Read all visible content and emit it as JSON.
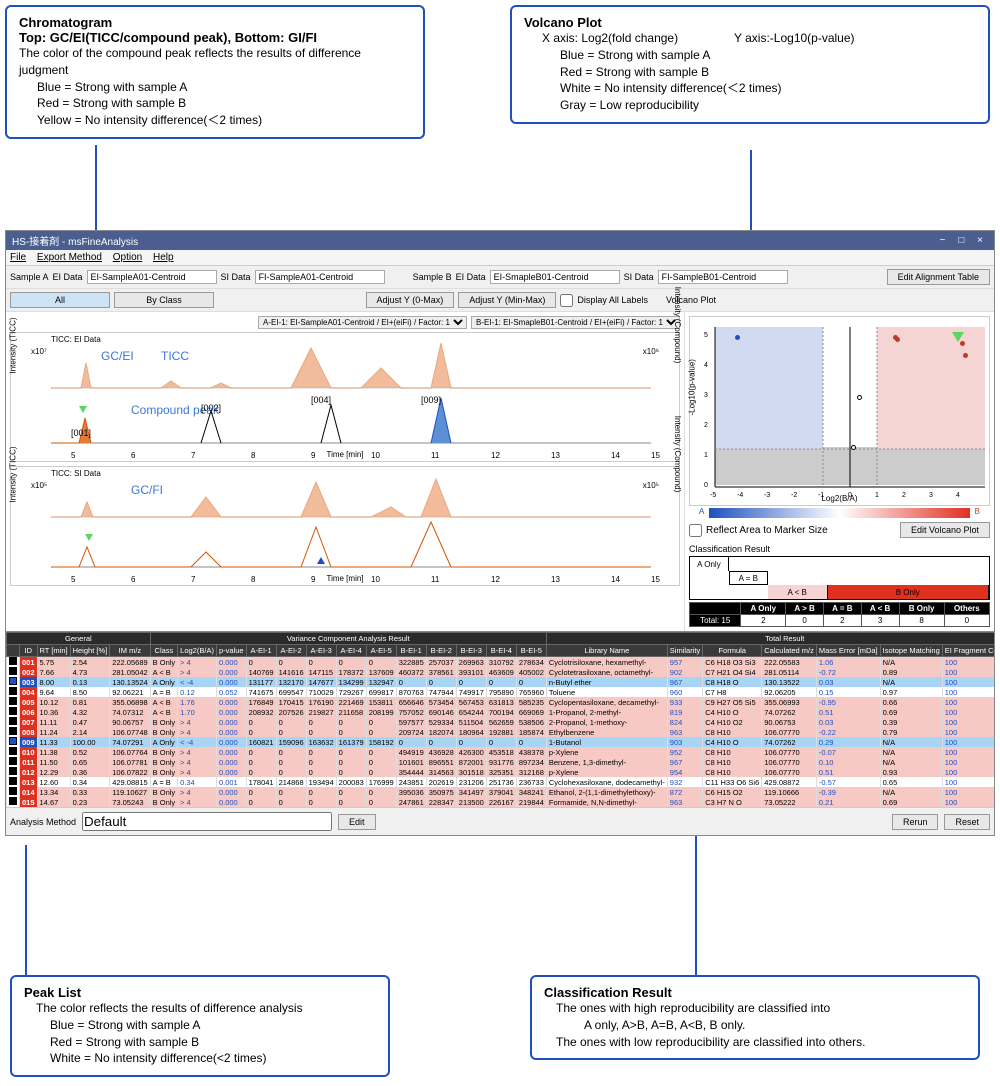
{
  "callouts": {
    "chromatogram": {
      "title": "Chromatogram",
      "subtitle": "Top: GC/EI(TICC/compound peak), Bottom: GI/FI",
      "desc": "The color of the compound peak reflects the results of difference judgment",
      "blue": "Blue = Strong with sample A",
      "red": "Red = Strong with sample B",
      "yellow": "Yellow = No intensity difference(＜2 times)"
    },
    "volcano": {
      "title": "Volcano Plot",
      "xaxis": "X axis: Log2(fold change)",
      "yaxis": "Y axis:-Log10(p-value)",
      "blue": "Blue = Strong with sample A",
      "red": "Red = Strong with sample B",
      "white": "White = No intensity difference(＜2 times)",
      "gray": "Gray = Low reproducibility"
    },
    "peaklist": {
      "title": "Peak List",
      "desc": "The color reflects the results of difference analysis",
      "blue": "Blue = Strong with sample A",
      "red": "Red = Strong with sample B",
      "white": "White = No intensity difference(<2 times)"
    },
    "classresult": {
      "title": "Classification Result",
      "line1": "The ones with high reproducibility are classified into",
      "line2": "A only, A>B, A=B, A<B, B only.",
      "line3": "The ones with low reproducibility are classified into others."
    }
  },
  "window": {
    "title": "HS-接着剤 - msFineAnalysis",
    "win_min": "−",
    "win_max": "□",
    "win_close": "×",
    "menu": {
      "file": "File",
      "export": "Export Method",
      "option": "Option",
      "help": "Help"
    },
    "sampleA": "Sample A",
    "sampleB": "Sample B",
    "eidata": "EI Data",
    "sidata": "SI Data",
    "eiA": "EI-SampleA01-Centroid",
    "siA": "FI-SampleA01-Centroid",
    "eiB": "EI-SmapleB01-Centroid",
    "siB": "FI-SampleB01-Centroid",
    "editAlign": "Edit Alignment Table",
    "btnAll": "All",
    "btnByClass": "By Class",
    "btnAdjY0": "Adjust Y (0-Max)",
    "btnAdjYmm": "Adjust Y (Min-Max)",
    "chkDisplayAll": "Display All Labels",
    "volcanoLabel": "Volcano Plot",
    "dropA": "A-EI-1: EI-SampleA01-Centroid / EI+(eiFi) / Factor: 1",
    "dropB": "B-EI-1: EI-SmapleB01-Centroid / EI+(eiFi) / Factor: 1",
    "analysisMethod": "Analysis Method",
    "analysisMethodVal": "Default",
    "editBtn": "Edit",
    "rerun": "Rerun",
    "reset": "Reset"
  },
  "chrom": {
    "ticc_ei": "TICC: EI Data",
    "ticc_si": "TICC: SI Data",
    "ylabel": "Intensity (TICC)",
    "ylabel2": "Intensity (Compound)",
    "xlabel": "Time [min]",
    "y1_left": "x10⁷",
    "y1_right": "x10⁶",
    "y2_left": "x10⁵",
    "y2_right": "x10⁵",
    "gcei": "GC/EI",
    "ticc": "TICC",
    "compound_peak": "Compound peak",
    "gcfi": "GC/FI",
    "tag001": "[001]",
    "tag002": "[002]",
    "tag004": "[004]",
    "tag009": "[009]"
  },
  "volcano": {
    "ylabel": "-Log10(p-value)",
    "xlabel": "Log2(B/A)",
    "labelA": "A",
    "labelB": "B",
    "chkReflect": "Reflect Area to Marker Size",
    "editBtn": "Edit Volcano Plot"
  },
  "classResult": {
    "title": "Classification Result",
    "aonly": "A Only",
    "aeqb": "A = B",
    "altb": "A < B",
    "bonly": "B Only",
    "headers": [
      "",
      "A Only",
      "A > B",
      "A = B",
      "A < B",
      "B Only",
      "Others"
    ],
    "row": [
      "Total: 15",
      "2",
      "0",
      "2",
      "3",
      "8",
      "0"
    ]
  },
  "table": {
    "groups": {
      "general": "General",
      "variance": "Variance Component Analysis Result",
      "total": "Total Result"
    },
    "headers": [
      "",
      "ID",
      "RT [min]",
      "Height [%]",
      "IM m/z",
      "Class",
      "Log2(B/A)",
      "p-value",
      "A-EI-1",
      "A-EI-2",
      "A-EI-3",
      "A-EI-4",
      "A-EI-5",
      "B-EI-1",
      "B-EI-2",
      "B-EI-3",
      "B-EI-4",
      "B-EI-5",
      "Library Name",
      "Similarity",
      "Formula",
      "Calculated m/z",
      "Mass Error [mDa]",
      "Isotope Matching",
      "EI Fragment Coverage"
    ],
    "rows": [
      {
        "cls": "red",
        "id": "001",
        "rt": "5.75",
        "h": "2.54",
        "mz": "222.05689",
        "class": "B Only",
        "log": "> 4",
        "p": "0.000",
        "a1": "0",
        "a2": "0",
        "a3": "0",
        "a4": "0",
        "a5": "0",
        "b1": "322885",
        "b2": "257037",
        "b3": "269963",
        "b4": "310792",
        "b5": "278634",
        "lib": "Cyclotrisiloxane, hexamethyl-",
        "sim": "957",
        "for": "C6 H18 O3 Si3",
        "cmz": "222.05583",
        "err": "1.06",
        "iso": "N/A",
        "cov": "100"
      },
      {
        "cls": "red",
        "id": "002",
        "rt": "7.66",
        "h": "4.73",
        "mz": "281.05042",
        "class": "A < B",
        "log": "> 4",
        "p": "0.000",
        "a1": "140769",
        "a2": "141616",
        "a3": "147115",
        "a4": "178372",
        "a5": "137609",
        "b1": "460372",
        "b2": "378561",
        "b3": "393101",
        "b4": "463609",
        "b5": "405002",
        "lib": "Cyclotetrasiloxane, octamethyl-",
        "sim": "902",
        "for": "C7 H21 O4 Si4",
        "cmz": "281.05114",
        "err": "-0.72",
        "iso": "0.89",
        "cov": "100"
      },
      {
        "cls": "blue",
        "id": "003",
        "rt": "8.00",
        "h": "0.13",
        "mz": "130.13524",
        "class": "A Only",
        "log": "< -4",
        "p": "0.000",
        "a1": "131177",
        "a2": "132170",
        "a3": "147677",
        "a4": "134299",
        "a5": "132947",
        "b1": "0",
        "b2": "0",
        "b3": "0",
        "b4": "0",
        "b5": "0",
        "lib": "n-Butyl ether",
        "sim": "967",
        "for": "C8 H18 O",
        "cmz": "130.13522",
        "err": "0.03",
        "iso": "N/A",
        "cov": "100"
      },
      {
        "cls": "white",
        "id": "004",
        "rt": "9.64",
        "h": "8.50",
        "mz": "92.06221",
        "class": "A = B",
        "log": "0.12",
        "p": "0.052",
        "a1": "741675",
        "a2": "699547",
        "a3": "710029",
        "a4": "729267",
        "a5": "699817",
        "b1": "870763",
        "b2": "747944",
        "b3": "749917",
        "b4": "795890",
        "b5": "765960",
        "lib": "Toluene",
        "sim": "960",
        "for": "C7 H8",
        "cmz": "92.06205",
        "err": "0.15",
        "iso": "0.97",
        "cov": "100"
      },
      {
        "cls": "red",
        "id": "005",
        "rt": "10.12",
        "h": "0.81",
        "mz": "355.06898",
        "class": "A < B",
        "log": "1.76",
        "p": "0.000",
        "a1": "176849",
        "a2": "170415",
        "a3": "176190",
        "a4": "221469",
        "a5": "153811",
        "b1": "656646",
        "b2": "573454",
        "b3": "567453",
        "b4": "631813",
        "b5": "585235",
        "lib": "Cyclopentasiloxane, decamethyl-",
        "sim": "933",
        "for": "C9 H27 O5 Si5",
        "cmz": "355.06993",
        "err": "-0.95",
        "iso": "0.66",
        "cov": "100"
      },
      {
        "cls": "red",
        "id": "006",
        "rt": "10.36",
        "h": "4.32",
        "mz": "74.07312",
        "class": "A < B",
        "log": "1.70",
        "p": "0.000",
        "a1": "208932",
        "a2": "207526",
        "a3": "219827",
        "a4": "211658",
        "a5": "208199",
        "b1": "757052",
        "b2": "690146",
        "b3": "654244",
        "b4": "700194",
        "b5": "669069",
        "lib": "1-Propanol, 2-methyl-",
        "sim": "819",
        "for": "C4 H10 O",
        "cmz": "74.07262",
        "err": "0.51",
        "iso": "0.69",
        "cov": "100"
      },
      {
        "cls": "red",
        "id": "007",
        "rt": "11.11",
        "h": "0.47",
        "mz": "90.06757",
        "class": "B Only",
        "log": "> 4",
        "p": "0.000",
        "a1": "0",
        "a2": "0",
        "a3": "0",
        "a4": "0",
        "a5": "0",
        "b1": "597577",
        "b2": "529334",
        "b3": "511504",
        "b4": "562659",
        "b5": "538506",
        "lib": "2-Propanol, 1-methoxy-",
        "sim": "824",
        "for": "C4 H10 O2",
        "cmz": "90.06753",
        "err": "0.03",
        "iso": "0.39",
        "cov": "100"
      },
      {
        "cls": "red",
        "id": "008",
        "rt": "11.24",
        "h": "2.14",
        "mz": "106.07748",
        "class": "B Only",
        "log": "> 4",
        "p": "0.000",
        "a1": "0",
        "a2": "0",
        "a3": "0",
        "a4": "0",
        "a5": "0",
        "b1": "209724",
        "b2": "182074",
        "b3": "180964",
        "b4": "192881",
        "b5": "185874",
        "lib": "Ethylbenzene",
        "sim": "963",
        "for": "C8 H10",
        "cmz": "106.07770",
        "err": "-0.22",
        "iso": "0.79",
        "cov": "100"
      },
      {
        "cls": "blue",
        "id": "009",
        "rt": "11.33",
        "h": "100.00",
        "mz": "74.07291",
        "class": "A Only",
        "log": "< -4",
        "p": "0.000",
        "a1": "160821",
        "a2": "159096",
        "a3": "163632",
        "a4": "161379",
        "a5": "158192",
        "b1": "0",
        "b2": "0",
        "b3": "0",
        "b4": "0",
        "b5": "0",
        "lib": "1-Butanol",
        "sim": "903",
        "for": "C4 H10 O",
        "cmz": "74.07262",
        "err": "0.29",
        "iso": "N/A",
        "cov": "100"
      },
      {
        "cls": "red",
        "id": "010",
        "rt": "11.38",
        "h": "0.52",
        "mz": "106.07764",
        "class": "B Only",
        "log": "> 4",
        "p": "0.000",
        "a1": "0",
        "a2": "0",
        "a3": "0",
        "a4": "0",
        "a5": "0",
        "b1": "494919",
        "b2": "436928",
        "b3": "426300",
        "b4": "453518",
        "b5": "438378",
        "lib": "p-Xylene",
        "sim": "952",
        "for": "C8 H10",
        "cmz": "106.07770",
        "err": "-0.07",
        "iso": "N/A",
        "cov": "100"
      },
      {
        "cls": "red",
        "id": "011",
        "rt": "11.50",
        "h": "0.65",
        "mz": "106.07781",
        "class": "B Only",
        "log": "> 4",
        "p": "0.000",
        "a1": "0",
        "a2": "0",
        "a3": "0",
        "a4": "0",
        "a5": "0",
        "b1": "101601",
        "b2": "896551",
        "b3": "872001",
        "b4": "931776",
        "b5": "897234",
        "lib": "Benzene, 1,3-dimethyl-",
        "sim": "967",
        "for": "C8 H10",
        "cmz": "106.07770",
        "err": "0.10",
        "iso": "N/A",
        "cov": "100"
      },
      {
        "cls": "red",
        "id": "012",
        "rt": "12.29",
        "h": "0.36",
        "mz": "106.07822",
        "class": "B Only",
        "log": "> 4",
        "p": "0.000",
        "a1": "0",
        "a2": "0",
        "a3": "0",
        "a4": "0",
        "a5": "0",
        "b1": "354444",
        "b2": "314563",
        "b3": "301518",
        "b4": "325351",
        "b5": "312168",
        "lib": "p-Xylene",
        "sim": "954",
        "for": "C8 H10",
        "cmz": "106.07770",
        "err": "0.51",
        "iso": "0.93",
        "cov": "100"
      },
      {
        "cls": "white",
        "id": "013",
        "rt": "12.60",
        "h": "0.34",
        "mz": "429.08815",
        "class": "A = B",
        "log": "0.34",
        "p": "0.001",
        "a1": "178041",
        "a2": "214868",
        "a3": "193494",
        "a4": "200083",
        "a5": "176999",
        "b1": "243851",
        "b2": "202619",
        "b3": "231206",
        "b4": "251736",
        "b5": "236733",
        "lib": "Cyclohexasiloxane, dodecamethyl-",
        "sim": "932",
        "for": "C11 H33 O6 Si6",
        "cmz": "429.08872",
        "err": "-0.57",
        "iso": "0.65",
        "cov": "100"
      },
      {
        "cls": "red",
        "id": "014",
        "rt": "13.34",
        "h": "0.33",
        "mz": "119.10627",
        "class": "B Only",
        "log": "> 4",
        "p": "0.000",
        "a1": "0",
        "a2": "0",
        "a3": "0",
        "a4": "0",
        "a5": "0",
        "b1": "395036",
        "b2": "350975",
        "b3": "341497",
        "b4": "379041",
        "b5": "348241",
        "lib": "Ethanol, 2-(1,1-dimethylethoxy)-",
        "sim": "872",
        "for": "C6 H15 O2",
        "cmz": "119.10666",
        "err": "-0.39",
        "iso": "N/A",
        "cov": "100"
      },
      {
        "cls": "red",
        "id": "015",
        "rt": "14.67",
        "h": "0.23",
        "mz": "73.05243",
        "class": "B Only",
        "log": "> 4",
        "p": "0.000",
        "a1": "0",
        "a2": "0",
        "a3": "0",
        "a4": "0",
        "a5": "0",
        "b1": "247861",
        "b2": "228347",
        "b3": "213500",
        "b4": "226167",
        "b5": "219844",
        "lib": "Formamide, N,N-dimethyl-",
        "sim": "963",
        "for": "C3 H7 N O",
        "cmz": "73.05222",
        "err": "0.21",
        "iso": "0.69",
        "cov": "100"
      }
    ]
  },
  "chart_data": {
    "type": "other",
    "chromatogram_ei": {
      "x_range": [
        5,
        15
      ],
      "y_left_exp": "x10^7",
      "y_right_exp": "x10^6",
      "peaks": [
        {
          "rt": 5.75,
          "tag": "001"
        },
        {
          "rt": 7.66,
          "tag": "002"
        },
        {
          "rt": 9.64,
          "tag": "004"
        },
        {
          "rt": 11.33,
          "tag": "009"
        }
      ]
    },
    "chromatogram_fi": {
      "x_range": [
        5,
        15
      ],
      "y_left_exp": "x10^5",
      "y_right_exp": "x10^5"
    },
    "volcano": {
      "x_range": [
        -5,
        5
      ],
      "y_range": [
        0,
        5.5
      ],
      "xlabel": "Log2(B/A)",
      "ylabel": "-Log10(p-value)",
      "regions": {
        "blue_x": [
          -5,
          -1
        ],
        "red_x": [
          1,
          5
        ],
        "gray_y": [
          0,
          1.3
        ]
      },
      "points": [
        {
          "x": -4.2,
          "y": 5.0,
          "color": "blue"
        },
        {
          "x": 0.12,
          "y": 1.28,
          "color": "white"
        },
        {
          "x": 0.34,
          "y": 3.0,
          "color": "white"
        },
        {
          "x": 1.7,
          "y": 5.0,
          "color": "red"
        },
        {
          "x": 1.76,
          "y": 5.0,
          "color": "red"
        },
        {
          "x": 4.0,
          "y": 5.0,
          "color": "green"
        },
        {
          "x": 4.2,
          "y": 4.8,
          "color": "red"
        },
        {
          "x": 4.3,
          "y": 4.4,
          "color": "red"
        }
      ]
    },
    "classification": {
      "a_only": 2,
      "a_gt_b": 0,
      "a_eq_b": 2,
      "a_lt_b": 3,
      "b_only": 8,
      "others": 0,
      "total": 15
    }
  }
}
